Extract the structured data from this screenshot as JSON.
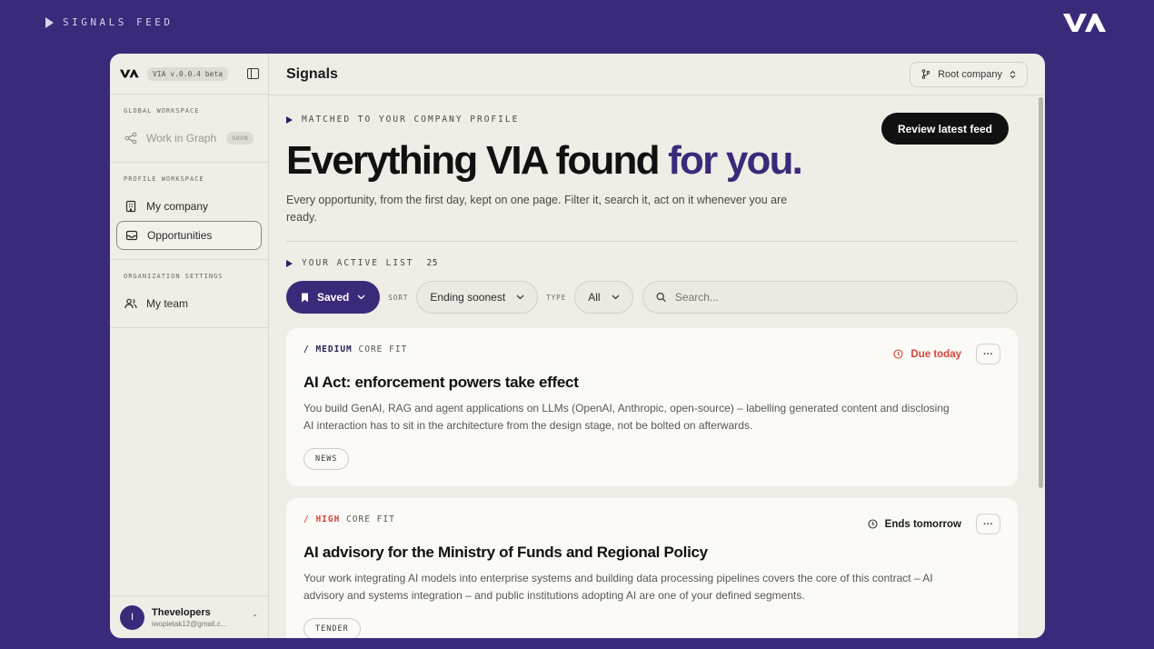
{
  "page_label": "SIGNALS FEED",
  "sidebar": {
    "version": "VIA v.0.0.4 beta",
    "sections": [
      {
        "title": "GLOBAL WORKSPACE",
        "items": [
          {
            "label": "Work in Graph",
            "badge": "SOON"
          }
        ]
      },
      {
        "title": "PROFILE WORKSPACE",
        "items": [
          {
            "label": "My company"
          },
          {
            "label": "Opportunities"
          }
        ]
      },
      {
        "title": "ORGANIZATION SETTINGS",
        "items": [
          {
            "label": "My team"
          }
        ]
      }
    ],
    "user": {
      "initial": "I",
      "name": "Thevelopers",
      "email": "iwopietak12@gmail.c..."
    }
  },
  "header": {
    "title": "Signals",
    "company_select": "Root company"
  },
  "hero": {
    "eyebrow": "MATCHED TO YOUR COMPANY PROFILE",
    "review_button": "Review latest feed",
    "title_main": "Everything VIA found ",
    "title_accent": "for you.",
    "lead": "Every opportunity, from the first day, kept on one page. Filter it, search it, act on it whenever you are ready."
  },
  "list": {
    "label": "YOUR ACTIVE LIST",
    "count": "25",
    "saved_button": "Saved",
    "sort_label": "SORT",
    "sort_value": "Ending soonest",
    "type_label": "TYPE",
    "type_value": "All",
    "search_placeholder": "Search..."
  },
  "cards": [
    {
      "prefix": "/ ",
      "level": "MEDIUM",
      "fit": " CORE FIT",
      "status": "Due today",
      "title": "AI Act: enforcement powers take effect",
      "desc": "You build GenAI, RAG and agent applications on LLMs (OpenAI, Anthropic, open-source) – labelling generated content and disclosing AI interaction has to sit in the architecture from the design stage, not be bolted on afterwards.",
      "tag": "NEWS",
      "more": "···"
    },
    {
      "prefix": "/ ",
      "level": "HIGH",
      "fit": " CORE FIT",
      "status": "Ends tomorrow",
      "title": "AI advisory for the Ministry of Funds and Regional Policy",
      "desc": "Your work integrating AI models into enterprise systems and building data processing pipelines covers the core of this contract – AI advisory and systems integration – and public institutions adopting AI are one of your defined segments.",
      "tag": "TENDER",
      "more": "···"
    }
  ],
  "colors": {
    "brand": "#3b2a7a",
    "due": "#d9443b",
    "background": "#efede6"
  },
  "icons": [
    "play-icon",
    "via-logo-icon",
    "panel-toggle-icon",
    "graph-icon",
    "building-icon",
    "inbox-icon",
    "team-icon",
    "branch-icon",
    "bookmark-icon",
    "chevron-down-icon",
    "search-icon",
    "clock-icon",
    "more-icon"
  ]
}
